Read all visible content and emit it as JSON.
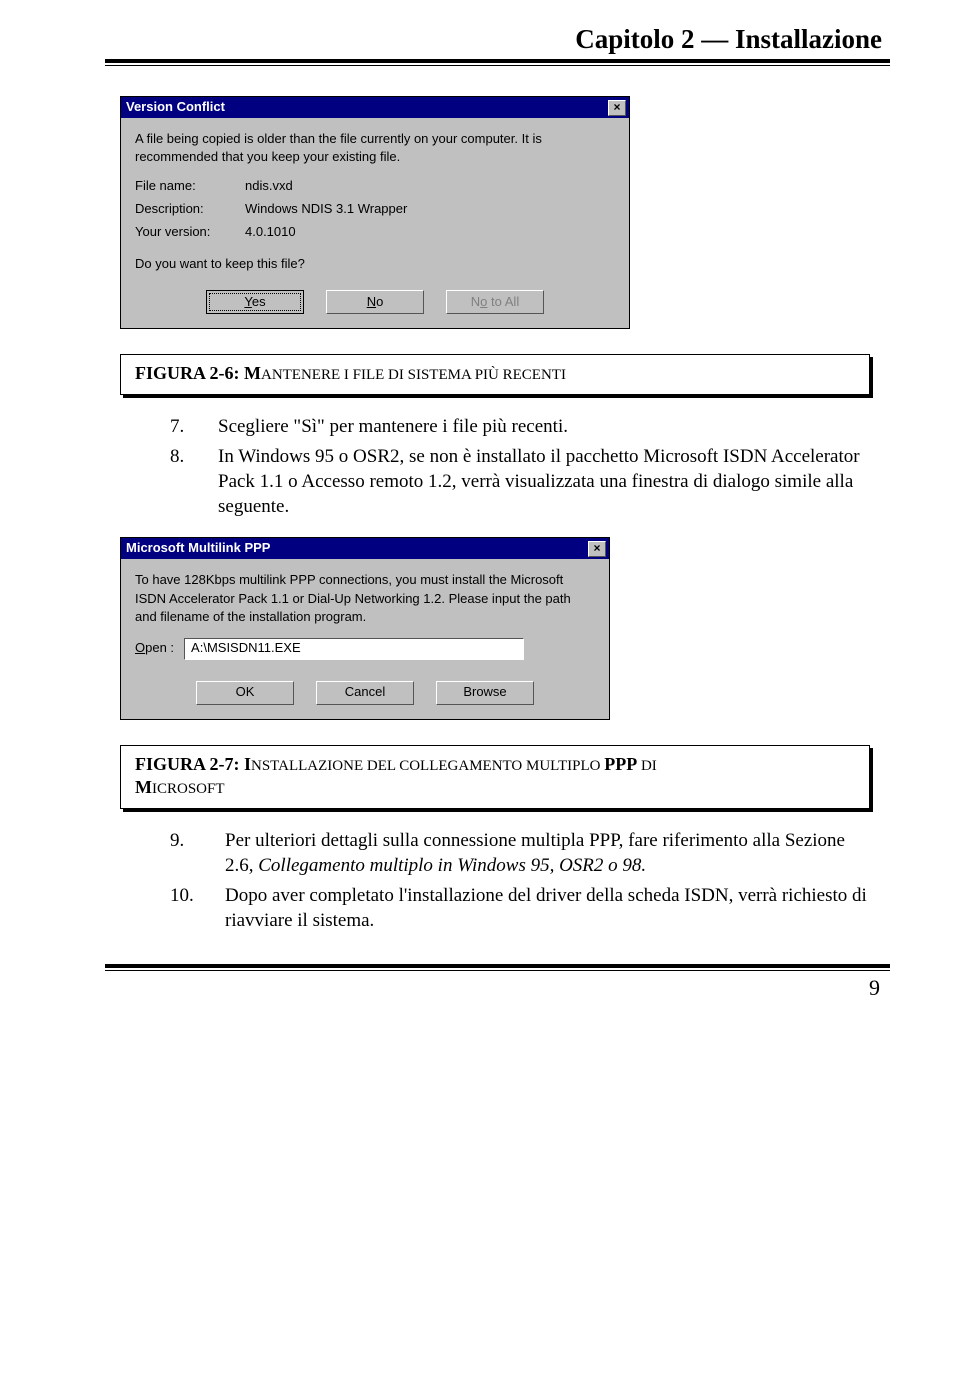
{
  "header": {
    "chapter_title": "Capitolo 2 — Installazione"
  },
  "dialog1": {
    "title": "Version Conflict",
    "close_label": "×",
    "message": "A file being copied is older than the file currently on your computer. It is recommended that you keep your existing file.",
    "rows": {
      "file_name_label": "File name:",
      "file_name_value": "ndis.vxd",
      "description_label": "Description:",
      "description_value": "Windows NDIS 3.1 Wrapper",
      "version_label": "Your version:",
      "version_value": "4.0.1010"
    },
    "prompt": "Do you want to keep this file?",
    "btn_yes_letter": "Y",
    "btn_yes_rest": "es",
    "btn_no_letter": "N",
    "btn_no_rest": "o",
    "btn_notoall_letter": "o",
    "btn_notoall_pre": "N",
    "btn_notoall_post": " to All"
  },
  "caption1": {
    "prefix": "FIGURA 2-6: M",
    "rest": "ANTENERE I FILE DI SISTEMA PIÙ RECENTI"
  },
  "list1": {
    "item7_num": "7.",
    "item7_text": "Scegliere \"Sì\" per mantenere i file più recenti.",
    "item8_num": "8.",
    "item8_text": "In Windows 95 o OSR2, se non è installato il pacchetto Microsoft ISDN Accelerator Pack 1.1 o Accesso remoto 1.2, verrà visualizzata una finestra di dialogo simile alla seguente."
  },
  "dialog2": {
    "title": "Microsoft Multilink PPP",
    "close_label": "×",
    "message": "To have 128Kbps multilink PPP connections, you must install the Microsoft ISDN Accelerator Pack 1.1 or Dial-Up Networking 1.2. Please input the path and filename of the installation program.",
    "open_letter": "O",
    "open_rest": "pen :",
    "open_value": "A:\\MSISDN11.EXE",
    "btn_ok": "OK",
    "btn_cancel": "Cancel",
    "btn_browse": "Browse"
  },
  "caption2": {
    "line1_prefix": "FIGURA 2-7: I",
    "line1_rest": "NSTALLAZIONE DEL COLLEGAMENTO MULTIPLO ",
    "line1_bold": "PPP",
    "line1_trail": " DI",
    "line2_prefix": "M",
    "line2_rest": "ICROSOFT"
  },
  "list2": {
    "item9_num": "9.",
    "item9_text_a": "Per ulteriori dettagli sulla connessione multipla PPP, fare riferimento alla Sezione 2.6, ",
    "item9_text_i": "Collegamento multiplo in Windows 95, OSR2 o 98.",
    "item10_num": "10.",
    "item10_text": "Dopo aver completato l'installazione del driver della scheda ISDN, verrà richiesto di riavviare il sistema."
  },
  "footer": {
    "page": "9"
  }
}
